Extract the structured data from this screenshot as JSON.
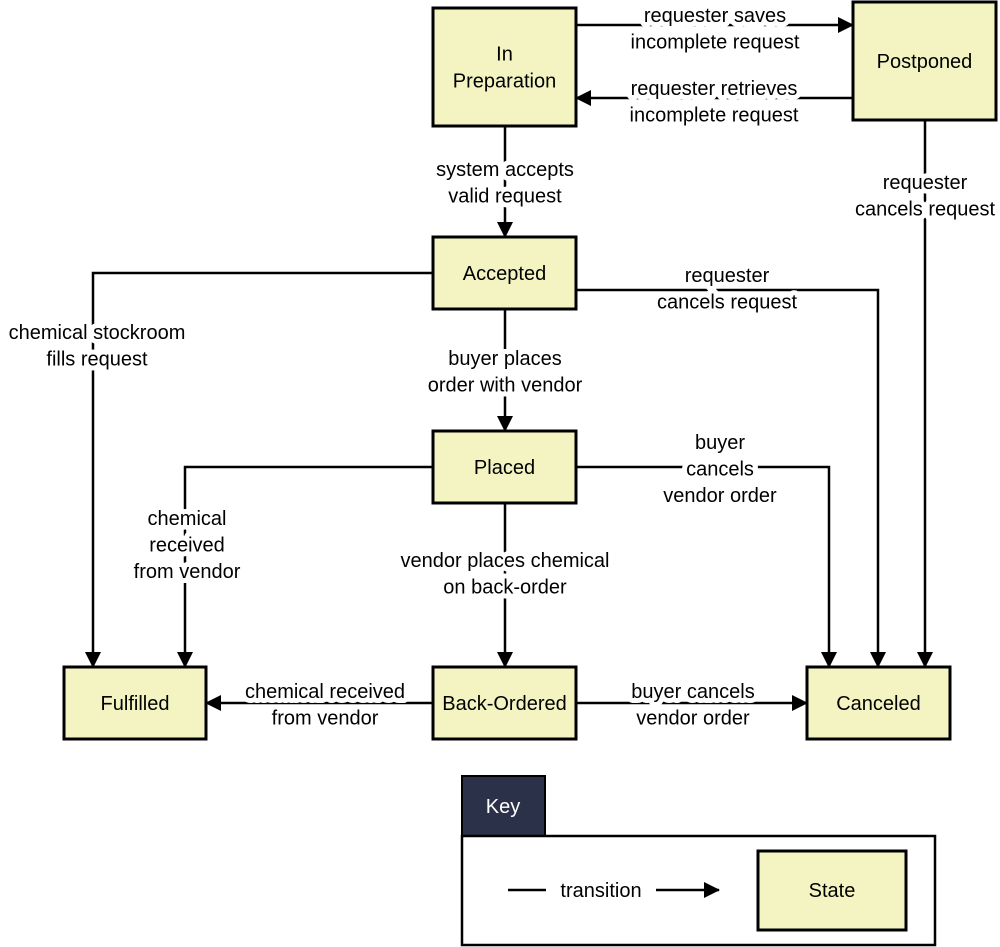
{
  "colors": {
    "state_fill": "#f3f4c2",
    "key_tab": "#2b3149",
    "line": "#000000"
  },
  "states": [
    {
      "id": "in_preparation",
      "label_lines": [
        "In",
        "Preparation"
      ]
    },
    {
      "id": "postponed",
      "label_lines": [
        "Postponed"
      ]
    },
    {
      "id": "accepted",
      "label_lines": [
        "Accepted"
      ]
    },
    {
      "id": "placed",
      "label_lines": [
        "Placed"
      ]
    },
    {
      "id": "fulfilled",
      "label_lines": [
        "Fulfilled"
      ]
    },
    {
      "id": "back_ordered",
      "label_lines": [
        "Back-Ordered"
      ]
    },
    {
      "id": "canceled",
      "label_lines": [
        "Canceled"
      ]
    }
  ],
  "transitions": [
    {
      "from": "in_preparation",
      "to": "postponed",
      "label_lines": [
        "requester saves",
        "incomplete request"
      ]
    },
    {
      "from": "postponed",
      "to": "in_preparation",
      "label_lines": [
        "requester retrieves",
        "incomplete request"
      ]
    },
    {
      "from": "in_preparation",
      "to": "accepted",
      "label_lines": [
        "system accepts",
        "valid request"
      ]
    },
    {
      "from": "postponed",
      "to": "canceled",
      "label_lines": [
        "requester",
        "cancels request"
      ]
    },
    {
      "from": "accepted",
      "to": "canceled",
      "label_lines": [
        "requester",
        "cancels request"
      ]
    },
    {
      "from": "accepted",
      "to": "fulfilled",
      "label_lines": [
        "chemical stockroom",
        "fills request"
      ]
    },
    {
      "from": "accepted",
      "to": "placed",
      "label_lines": [
        "buyer places",
        "order with vendor"
      ]
    },
    {
      "from": "placed",
      "to": "fulfilled",
      "label_lines": [
        "chemical",
        "received",
        "from vendor"
      ]
    },
    {
      "from": "placed",
      "to": "canceled",
      "label_lines": [
        "buyer",
        "cancels",
        "vendor order"
      ]
    },
    {
      "from": "placed",
      "to": "back_ordered",
      "label_lines": [
        "vendor places chemical",
        "on back-order"
      ]
    },
    {
      "from": "back_ordered",
      "to": "fulfilled",
      "label_lines": [
        "chemical received",
        "from vendor"
      ]
    },
    {
      "from": "back_ordered",
      "to": "canceled",
      "label_lines": [
        "buyer cancels",
        "vendor order"
      ]
    }
  ],
  "key": {
    "title": "Key",
    "transition_label": "transition",
    "state_label": "State"
  }
}
